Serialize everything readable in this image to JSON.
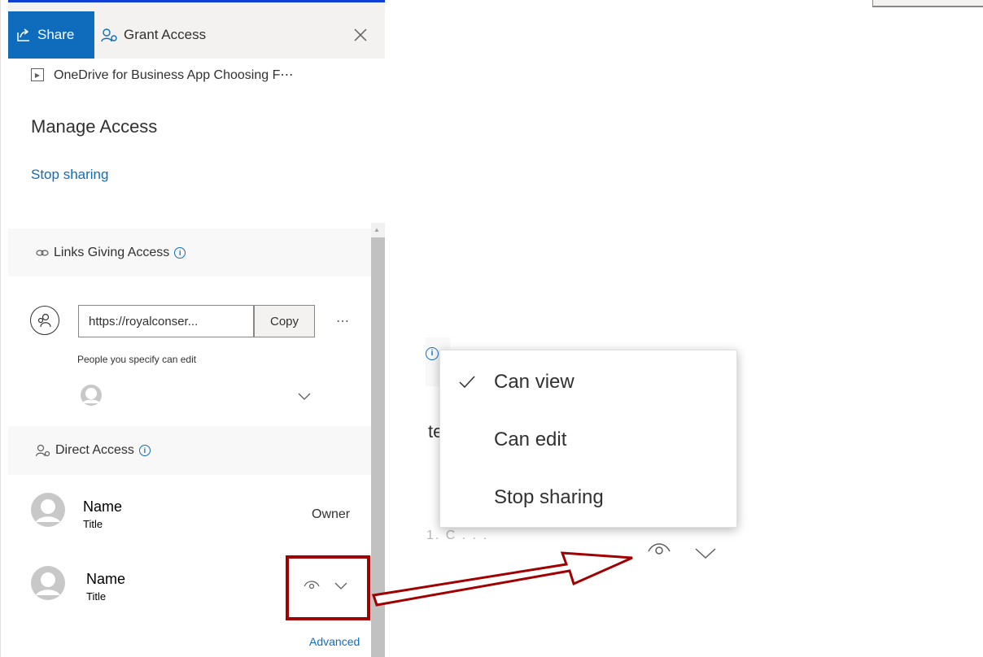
{
  "tabs": {
    "share_label": "Share",
    "grant_label": "Grant Access"
  },
  "file": {
    "name": "OneDrive for Business App Choosing F⋯"
  },
  "heading": "Manage Access",
  "stop_sharing_link": "Stop sharing",
  "links_section": {
    "header": "Links Giving Access",
    "url": "https://royalconser...",
    "copy_label": "Copy",
    "more_label": "⋯",
    "description": "People you specify can edit"
  },
  "direct_section": {
    "header": "Direct Access",
    "people": [
      {
        "name": "Name",
        "title": "Title",
        "role": "Owner"
      },
      {
        "name": "Name",
        "title": "Title"
      }
    ]
  },
  "advanced_label": "Advanced",
  "callout": {
    "partial_text": "te",
    "fragment_text": "1. C  . . .",
    "menu_items": [
      {
        "label": "Can view",
        "checked": true
      },
      {
        "label": "Can edit",
        "checked": false
      },
      {
        "label": "Stop sharing",
        "checked": false
      }
    ]
  },
  "colors": {
    "accent": "#0f6cbd",
    "highlight": "#a00000"
  },
  "icons": {
    "share": "share-icon",
    "grant": "grant-access-icon",
    "close": "close-icon",
    "eye": "eye-icon",
    "chevron": "chevron-down-icon",
    "check": "checkmark-icon"
  }
}
